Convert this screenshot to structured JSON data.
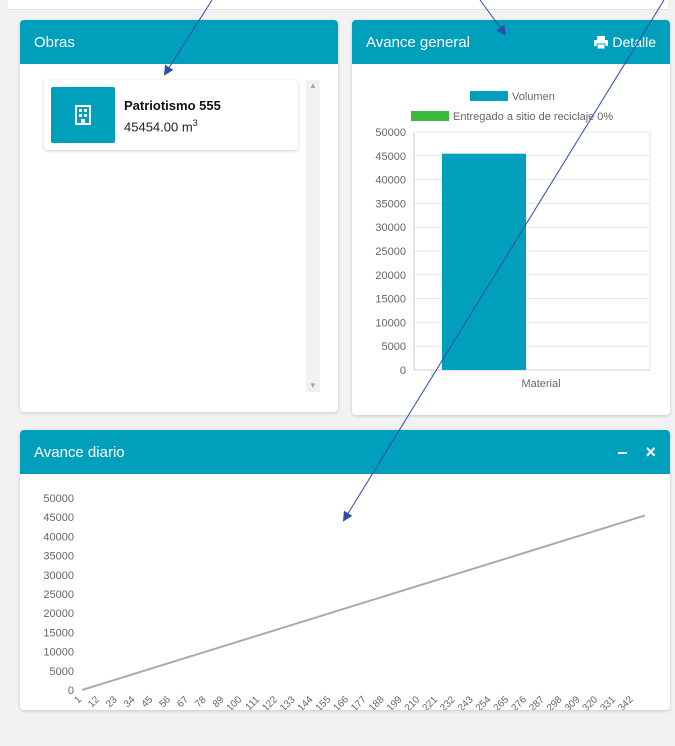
{
  "obras": {
    "title": "Obras",
    "items": [
      {
        "name": "Patriotismo 555",
        "quantity": "45454.00 m",
        "unit_sup": "3",
        "icon": "building-icon"
      }
    ]
  },
  "general": {
    "title": "Avance general",
    "detail_label": "Detalle",
    "detail_icon": "print-icon"
  },
  "diario": {
    "title": "Avance diario",
    "minimize_label": "–",
    "close_label": "×"
  },
  "colors": {
    "header": "#00a0bc",
    "bar": "#00a0bc",
    "legend_green": "#3cb93c",
    "line": "#aaaaaa",
    "arrow": "#2f4fa8"
  },
  "chart_data": [
    {
      "type": "bar",
      "categories": [
        "Material"
      ],
      "series": [
        {
          "name": "Volumen",
          "values": [
            45454
          ]
        },
        {
          "name": "Entregado a sitio de reciclaje 0%",
          "values": [
            0
          ]
        }
      ],
      "ylim": [
        0,
        50000
      ],
      "yticks": [
        0,
        5000,
        10000,
        15000,
        20000,
        25000,
        30000,
        35000,
        40000,
        45000,
        50000
      ],
      "legend_position": "top"
    },
    {
      "type": "line",
      "x_start": 1,
      "x_end": 349,
      "xticks": [
        1,
        12,
        23,
        34,
        45,
        56,
        67,
        78,
        89,
        100,
        111,
        122,
        133,
        144,
        155,
        166,
        177,
        188,
        199,
        210,
        221,
        232,
        243,
        254,
        265,
        276,
        287,
        298,
        309,
        320,
        331,
        342
      ],
      "series": [
        {
          "values_start": 0,
          "values_end": 45454
        }
      ],
      "ylim": [
        0,
        50000
      ],
      "yticks": [
        0,
        5000,
        10000,
        15000,
        20000,
        25000,
        30000,
        35000,
        40000,
        45000,
        50000
      ]
    }
  ]
}
